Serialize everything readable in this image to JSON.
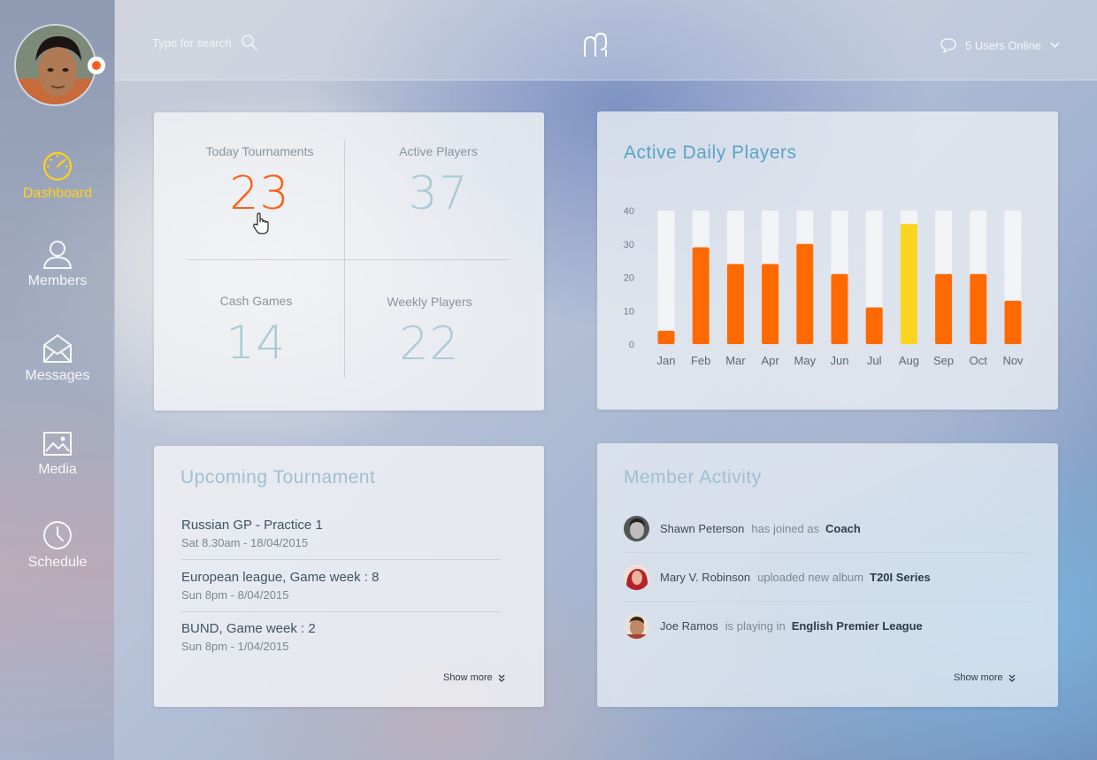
{
  "header": {
    "search_placeholder": "Type for search",
    "users_online": "5 Users Online"
  },
  "sidebar": {
    "items": [
      {
        "label": "Dashboard",
        "icon": "speedometer-icon",
        "active": true
      },
      {
        "label": "Members",
        "icon": "user-icon",
        "active": false
      },
      {
        "label": "Messages",
        "icon": "envelope-icon",
        "active": false
      },
      {
        "label": "Media",
        "icon": "image-icon",
        "active": false
      },
      {
        "label": "Schedule",
        "icon": "clock-icon",
        "active": false
      }
    ]
  },
  "stats": {
    "today_tournaments": {
      "label": "Today Tournaments",
      "value": "23"
    },
    "active_players": {
      "label": "Active Players",
      "value": "37"
    },
    "cash_games": {
      "label": "Cash Games",
      "value": "14"
    },
    "weekly_players": {
      "label": "Weekly Players",
      "value": "22"
    }
  },
  "chart": {
    "title": "Active Daily Players"
  },
  "chart_data": {
    "type": "bar",
    "title": "Active Daily Players",
    "categories": [
      "Jan",
      "Feb",
      "Mar",
      "Apr",
      "May",
      "Jun",
      "Jul",
      "Aug",
      "Sep",
      "Oct",
      "Nov"
    ],
    "values": [
      4,
      29,
      24,
      24,
      30,
      21,
      11,
      36,
      21,
      21,
      13
    ],
    "highlight_category": "Aug",
    "yticks": [
      "40",
      "30",
      "20",
      "10",
      "0"
    ],
    "ylim": [
      0,
      40
    ],
    "colors": {
      "bar": "#ff6a00",
      "highlight": "#fbd420",
      "track": "#f1f3f7"
    }
  },
  "tournaments": {
    "title": "Upcoming Tournament",
    "items": [
      {
        "name": "Russian GP - Practice 1",
        "date": "Sat 8.30am - 18/04/2015"
      },
      {
        "name": "European league, Game week : 8",
        "date": "Sun 8pm - 8/04/2015"
      },
      {
        "name": "BUND, Game week : 2",
        "date": "Sun 8pm - 1/04/2015"
      }
    ],
    "show_more": "Show more"
  },
  "activity": {
    "title": "Member Activity",
    "items": [
      {
        "who": "Shawn Peterson",
        "verb": "has joined as",
        "what": "Coach"
      },
      {
        "who": "Mary V. Robinson",
        "verb": "uploaded new album",
        "what": "T20I Series"
      },
      {
        "who": "Joe Ramos",
        "verb": "is playing in",
        "what": "English Premier League"
      }
    ],
    "show_more": "Show more"
  },
  "colors": {
    "accent_orange": "#ff5e14",
    "accent_yellow": "#ffd21a",
    "stat_blue": "#a8cbd6"
  }
}
